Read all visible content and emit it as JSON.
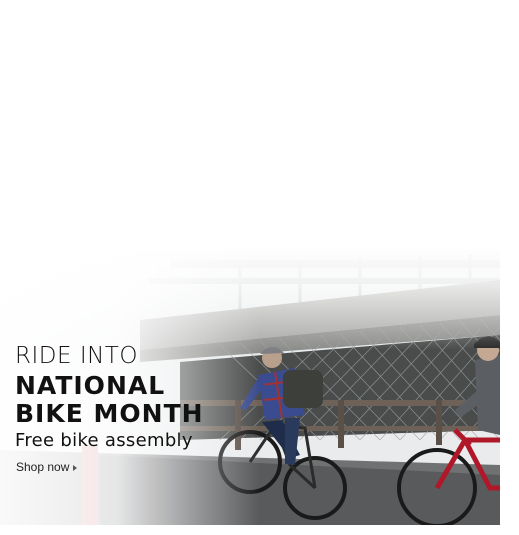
{
  "banner": {
    "line1": "RIDE INTO",
    "line2": "NATIONAL",
    "line3": "BIKE MONTH",
    "subhead": "Free bike assembly",
    "cta_label": "Shop now"
  },
  "icons": {
    "cta_arrow": "caret-right-icon"
  },
  "colors": {
    "headline": "#111111",
    "bike_red": "#b0182a",
    "jacket_plaid": "#3b4b8f"
  }
}
